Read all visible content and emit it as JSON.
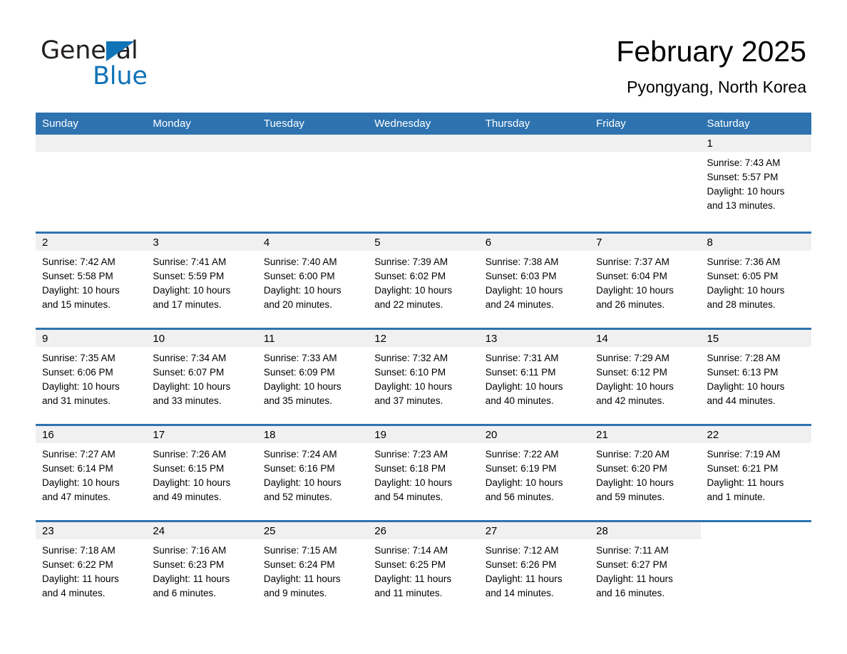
{
  "brand": {
    "name_part1": "General",
    "name_part2": "Blue",
    "accent_color": "#1073b8"
  },
  "header": {
    "title": "February 2025",
    "subtitle": "Pyongyang, North Korea"
  },
  "theme": {
    "header_blue": "#2e73b0",
    "daynum_band": "#f0f0f0",
    "text": "#000000"
  },
  "weekday_headers": [
    "Sunday",
    "Monday",
    "Tuesday",
    "Wednesday",
    "Thursday",
    "Friday",
    "Saturday"
  ],
  "weeks": [
    [
      {
        "day": "",
        "sunrise": "",
        "sunset": "",
        "daylight1": "",
        "daylight2": "",
        "blank": true
      },
      {
        "day": "",
        "sunrise": "",
        "sunset": "",
        "daylight1": "",
        "daylight2": "",
        "blank": true
      },
      {
        "day": "",
        "sunrise": "",
        "sunset": "",
        "daylight1": "",
        "daylight2": "",
        "blank": true
      },
      {
        "day": "",
        "sunrise": "",
        "sunset": "",
        "daylight1": "",
        "daylight2": "",
        "blank": true
      },
      {
        "day": "",
        "sunrise": "",
        "sunset": "",
        "daylight1": "",
        "daylight2": "",
        "blank": true
      },
      {
        "day": "",
        "sunrise": "",
        "sunset": "",
        "daylight1": "",
        "daylight2": "",
        "blank": true
      },
      {
        "day": "1",
        "sunrise": "Sunrise: 7:43 AM",
        "sunset": "Sunset: 5:57 PM",
        "daylight1": "Daylight: 10 hours",
        "daylight2": "and 13 minutes.",
        "blank": false
      }
    ],
    [
      {
        "day": "2",
        "sunrise": "Sunrise: 7:42 AM",
        "sunset": "Sunset: 5:58 PM",
        "daylight1": "Daylight: 10 hours",
        "daylight2": "and 15 minutes.",
        "blank": false
      },
      {
        "day": "3",
        "sunrise": "Sunrise: 7:41 AM",
        "sunset": "Sunset: 5:59 PM",
        "daylight1": "Daylight: 10 hours",
        "daylight2": "and 17 minutes.",
        "blank": false
      },
      {
        "day": "4",
        "sunrise": "Sunrise: 7:40 AM",
        "sunset": "Sunset: 6:00 PM",
        "daylight1": "Daylight: 10 hours",
        "daylight2": "and 20 minutes.",
        "blank": false
      },
      {
        "day": "5",
        "sunrise": "Sunrise: 7:39 AM",
        "sunset": "Sunset: 6:02 PM",
        "daylight1": "Daylight: 10 hours",
        "daylight2": "and 22 minutes.",
        "blank": false
      },
      {
        "day": "6",
        "sunrise": "Sunrise: 7:38 AM",
        "sunset": "Sunset: 6:03 PM",
        "daylight1": "Daylight: 10 hours",
        "daylight2": "and 24 minutes.",
        "blank": false
      },
      {
        "day": "7",
        "sunrise": "Sunrise: 7:37 AM",
        "sunset": "Sunset: 6:04 PM",
        "daylight1": "Daylight: 10 hours",
        "daylight2": "and 26 minutes.",
        "blank": false
      },
      {
        "day": "8",
        "sunrise": "Sunrise: 7:36 AM",
        "sunset": "Sunset: 6:05 PM",
        "daylight1": "Daylight: 10 hours",
        "daylight2": "and 28 minutes.",
        "blank": false
      }
    ],
    [
      {
        "day": "9",
        "sunrise": "Sunrise: 7:35 AM",
        "sunset": "Sunset: 6:06 PM",
        "daylight1": "Daylight: 10 hours",
        "daylight2": "and 31 minutes.",
        "blank": false
      },
      {
        "day": "10",
        "sunrise": "Sunrise: 7:34 AM",
        "sunset": "Sunset: 6:07 PM",
        "daylight1": "Daylight: 10 hours",
        "daylight2": "and 33 minutes.",
        "blank": false
      },
      {
        "day": "11",
        "sunrise": "Sunrise: 7:33 AM",
        "sunset": "Sunset: 6:09 PM",
        "daylight1": "Daylight: 10 hours",
        "daylight2": "and 35 minutes.",
        "blank": false
      },
      {
        "day": "12",
        "sunrise": "Sunrise: 7:32 AM",
        "sunset": "Sunset: 6:10 PM",
        "daylight1": "Daylight: 10 hours",
        "daylight2": "and 37 minutes.",
        "blank": false
      },
      {
        "day": "13",
        "sunrise": "Sunrise: 7:31 AM",
        "sunset": "Sunset: 6:11 PM",
        "daylight1": "Daylight: 10 hours",
        "daylight2": "and 40 minutes.",
        "blank": false
      },
      {
        "day": "14",
        "sunrise": "Sunrise: 7:29 AM",
        "sunset": "Sunset: 6:12 PM",
        "daylight1": "Daylight: 10 hours",
        "daylight2": "and 42 minutes.",
        "blank": false
      },
      {
        "day": "15",
        "sunrise": "Sunrise: 7:28 AM",
        "sunset": "Sunset: 6:13 PM",
        "daylight1": "Daylight: 10 hours",
        "daylight2": "and 44 minutes.",
        "blank": false
      }
    ],
    [
      {
        "day": "16",
        "sunrise": "Sunrise: 7:27 AM",
        "sunset": "Sunset: 6:14 PM",
        "daylight1": "Daylight: 10 hours",
        "daylight2": "and 47 minutes.",
        "blank": false
      },
      {
        "day": "17",
        "sunrise": "Sunrise: 7:26 AM",
        "sunset": "Sunset: 6:15 PM",
        "daylight1": "Daylight: 10 hours",
        "daylight2": "and 49 minutes.",
        "blank": false
      },
      {
        "day": "18",
        "sunrise": "Sunrise: 7:24 AM",
        "sunset": "Sunset: 6:16 PM",
        "daylight1": "Daylight: 10 hours",
        "daylight2": "and 52 minutes.",
        "blank": false
      },
      {
        "day": "19",
        "sunrise": "Sunrise: 7:23 AM",
        "sunset": "Sunset: 6:18 PM",
        "daylight1": "Daylight: 10 hours",
        "daylight2": "and 54 minutes.",
        "blank": false
      },
      {
        "day": "20",
        "sunrise": "Sunrise: 7:22 AM",
        "sunset": "Sunset: 6:19 PM",
        "daylight1": "Daylight: 10 hours",
        "daylight2": "and 56 minutes.",
        "blank": false
      },
      {
        "day": "21",
        "sunrise": "Sunrise: 7:20 AM",
        "sunset": "Sunset: 6:20 PM",
        "daylight1": "Daylight: 10 hours",
        "daylight2": "and 59 minutes.",
        "blank": false
      },
      {
        "day": "22",
        "sunrise": "Sunrise: 7:19 AM",
        "sunset": "Sunset: 6:21 PM",
        "daylight1": "Daylight: 11 hours",
        "daylight2": "and 1 minute.",
        "blank": false
      }
    ],
    [
      {
        "day": "23",
        "sunrise": "Sunrise: 7:18 AM",
        "sunset": "Sunset: 6:22 PM",
        "daylight1": "Daylight: 11 hours",
        "daylight2": "and 4 minutes.",
        "blank": false
      },
      {
        "day": "24",
        "sunrise": "Sunrise: 7:16 AM",
        "sunset": "Sunset: 6:23 PM",
        "daylight1": "Daylight: 11 hours",
        "daylight2": "and 6 minutes.",
        "blank": false
      },
      {
        "day": "25",
        "sunrise": "Sunrise: 7:15 AM",
        "sunset": "Sunset: 6:24 PM",
        "daylight1": "Daylight: 11 hours",
        "daylight2": "and 9 minutes.",
        "blank": false
      },
      {
        "day": "26",
        "sunrise": "Sunrise: 7:14 AM",
        "sunset": "Sunset: 6:25 PM",
        "daylight1": "Daylight: 11 hours",
        "daylight2": "and 11 minutes.",
        "blank": false
      },
      {
        "day": "27",
        "sunrise": "Sunrise: 7:12 AM",
        "sunset": "Sunset: 6:26 PM",
        "daylight1": "Daylight: 11 hours",
        "daylight2": "and 14 minutes.",
        "blank": false
      },
      {
        "day": "28",
        "sunrise": "Sunrise: 7:11 AM",
        "sunset": "Sunset: 6:27 PM",
        "daylight1": "Daylight: 11 hours",
        "daylight2": "and 16 minutes.",
        "blank": false
      },
      {
        "day": "",
        "sunrise": "",
        "sunset": "",
        "daylight1": "",
        "daylight2": "",
        "blank": true,
        "nogap": true
      }
    ]
  ]
}
